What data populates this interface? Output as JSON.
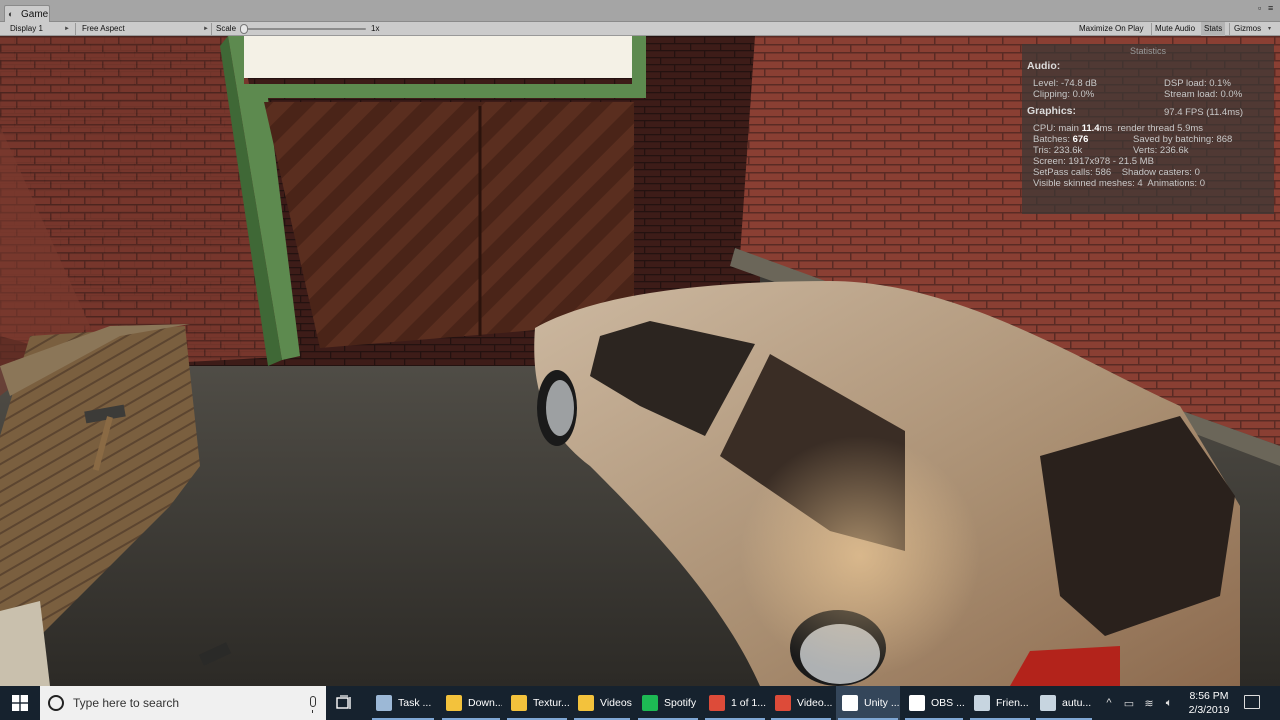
{
  "editor": {
    "tab_label": "Game",
    "toolbar": {
      "display": "Display 1",
      "aspect": "Free Aspect",
      "scale_label": "Scale",
      "scale_value": "1x",
      "buttons": [
        "Maximize On Play",
        "Mute Audio",
        "Stats",
        "Gizmos"
      ]
    }
  },
  "stats": {
    "title": "Statistics",
    "audio_heading": "Audio:",
    "audio_left": [
      "Level: -74.8 dB",
      "Clipping: 0.0%"
    ],
    "audio_right": [
      "DSP load: 0.1%",
      "Stream load: 0.0%"
    ],
    "graphics_heading": "Graphics:",
    "fps": "97.4 FPS (11.4ms)",
    "cpu_prefix": "CPU: main ",
    "cpu_main": "11.4",
    "cpu_suffix": "ms  render thread 5.9ms",
    "batches_prefix": "Batches: ",
    "batches": "676",
    "batches_saved": "Saved by batching: 868",
    "tris": "Tris: 233.6k",
    "verts": "Verts: 236.6k",
    "screen": "Screen: 1917x978 - 21.5 MB",
    "setpass": "SetPass calls: 586    Shadow casters: 0",
    "skinned": "Visible skinned meshes: 4  Animations: 0"
  },
  "taskbar": {
    "search_placeholder": "Type here to search",
    "apps": [
      {
        "label": "Task ...",
        "icon": "task-manager-icon",
        "color": "#9cb8d6",
        "glyph": ""
      },
      {
        "label": "Down...",
        "icon": "folder-icon",
        "color": "#f3c23c",
        "glyph": ""
      },
      {
        "label": "Textur...",
        "icon": "folder-icon",
        "color": "#f3c23c",
        "glyph": ""
      },
      {
        "label": "Videos",
        "icon": "folder-icon",
        "color": "#f3c23c",
        "glyph": ""
      },
      {
        "label": "Spotify",
        "icon": "spotify-icon",
        "color": "#1db954",
        "glyph": ""
      },
      {
        "label": "1 of 1...",
        "icon": "chrome-icon",
        "color": "#dd4b39",
        "glyph": ""
      },
      {
        "label": "Video...",
        "icon": "chrome-icon",
        "color": "#dd4b39",
        "glyph": ""
      },
      {
        "label": "Unity ...",
        "icon": "unity-icon",
        "color": "#ffffff",
        "glyph": ""
      },
      {
        "label": "OBS ...",
        "icon": "obs-icon",
        "color": "#ffffff",
        "glyph": ""
      },
      {
        "label": "Frien...",
        "icon": "steam-icon",
        "color": "#c7d5e0",
        "glyph": ""
      },
      {
        "label": "autu...",
        "icon": "steam-icon",
        "color": "#c7d5e0",
        "glyph": ""
      }
    ],
    "time": "8:56 PM",
    "date": "2/3/2019"
  }
}
